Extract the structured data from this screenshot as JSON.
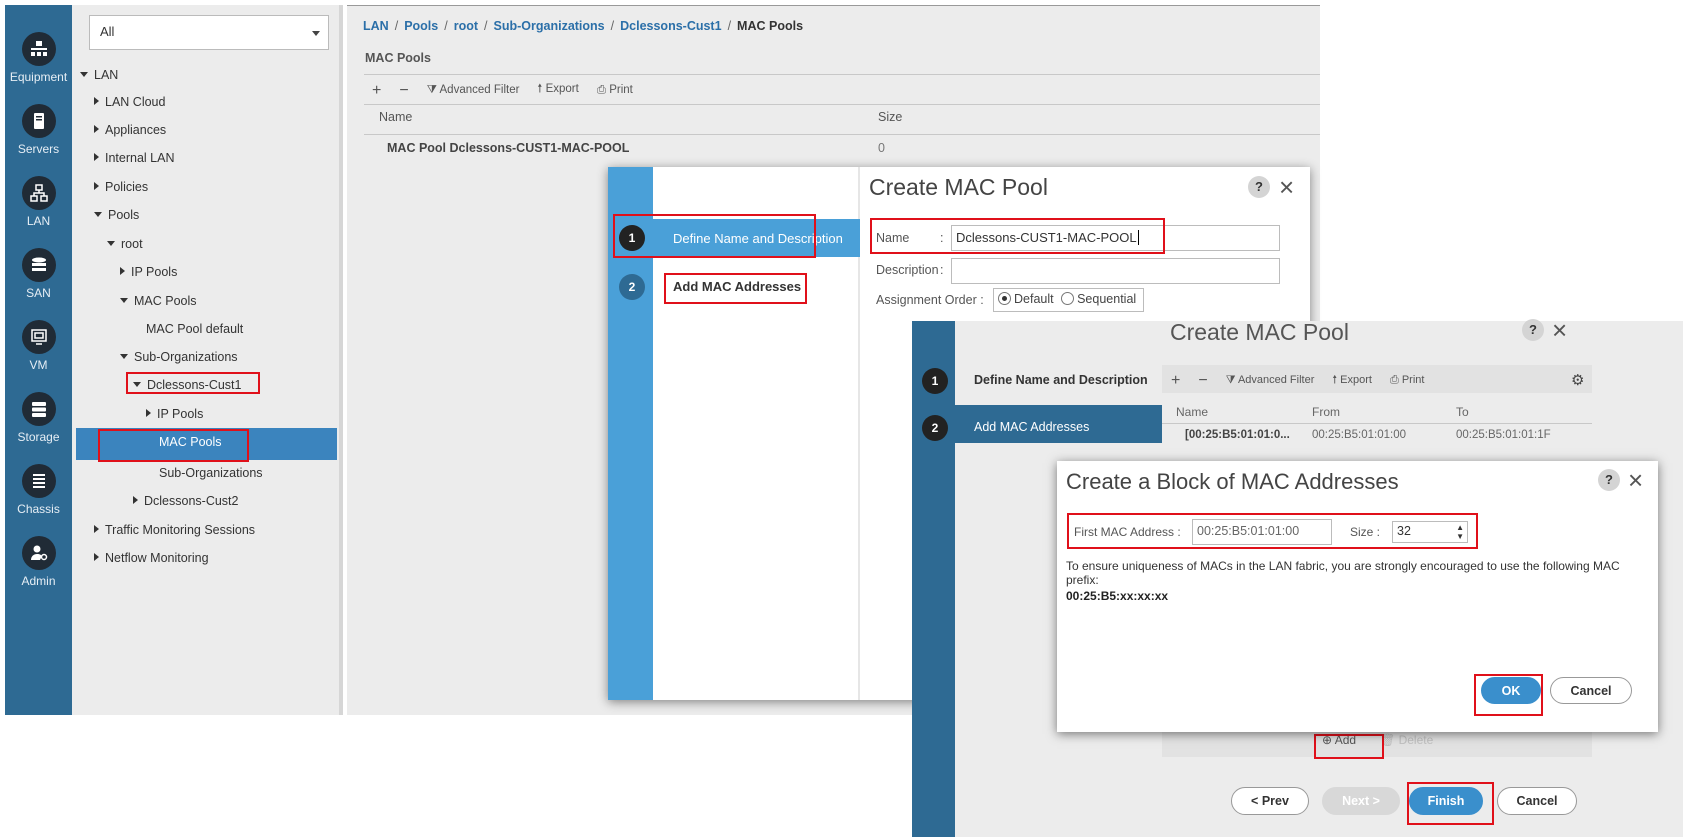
{
  "rail": {
    "items": [
      {
        "label": "Equipment",
        "icon": "equipment-icon"
      },
      {
        "label": "Servers",
        "icon": "server-icon"
      },
      {
        "label": "LAN",
        "icon": "lan-icon"
      },
      {
        "label": "SAN",
        "icon": "san-icon"
      },
      {
        "label": "VM",
        "icon": "vm-icon"
      },
      {
        "label": "Storage",
        "icon": "storage-icon"
      },
      {
        "label": "Chassis",
        "icon": "chassis-icon"
      },
      {
        "label": "Admin",
        "icon": "admin-icon"
      }
    ],
    "active": "LAN"
  },
  "tree": {
    "filter_value": "All",
    "nodes": [
      {
        "label": "LAN",
        "state": "expanded"
      },
      {
        "label": "LAN Cloud",
        "state": "collapsed"
      },
      {
        "label": "Appliances",
        "state": "collapsed"
      },
      {
        "label": "Internal LAN",
        "state": "collapsed"
      },
      {
        "label": "Policies",
        "state": "collapsed"
      },
      {
        "label": "Pools",
        "state": "expanded"
      },
      {
        "label": "root",
        "state": "expanded"
      },
      {
        "label": "IP Pools",
        "state": "collapsed"
      },
      {
        "label": "MAC Pools",
        "state": "expanded"
      },
      {
        "label": "MAC Pool default",
        "state": "leaf"
      },
      {
        "label": "Sub-Organizations",
        "state": "expanded"
      },
      {
        "label": "Dclessons-Cust1",
        "state": "expanded"
      },
      {
        "label": "IP Pools",
        "state": "collapsed"
      },
      {
        "label": "MAC Pools",
        "state": "selected"
      },
      {
        "label": "Sub-Organizations",
        "state": "leaf"
      },
      {
        "label": "Dclessons-Cust2",
        "state": "collapsed"
      },
      {
        "label": "Traffic Monitoring Sessions",
        "state": "collapsed"
      },
      {
        "label": "Netflow Monitoring",
        "state": "collapsed"
      }
    ]
  },
  "main": {
    "breadcrumb": [
      "LAN",
      "Pools",
      "root",
      "Sub-Organizations",
      "Dclessons-Cust1",
      "MAC Pools"
    ],
    "section_title": "MAC Pools",
    "toolbar": {
      "add": "+",
      "remove": "−",
      "filter": "Advanced Filter",
      "export": "Export",
      "print": "Print"
    },
    "table": {
      "columns": [
        "Name",
        "Size"
      ],
      "rows": [
        {
          "name": "MAC Pool Dclessons-CUST1-MAC-POOL",
          "size": "0"
        }
      ]
    }
  },
  "dialog1": {
    "title": "Create MAC Pool",
    "help": "?",
    "steps": [
      {
        "num": "1",
        "label": "Define Name and Description"
      },
      {
        "num": "2",
        "label": "Add MAC Addresses"
      }
    ],
    "name_label": "Name",
    "name_value": "Dclessons-CUST1-MAC-POOL",
    "description_label": "Description",
    "description_value": "",
    "assignment_label": "Assignment Order :",
    "assignment_options": [
      "Default",
      "Sequential"
    ],
    "assignment_selected": "Default"
  },
  "dialog2": {
    "title": "Create MAC Pool",
    "help": "?",
    "steps": [
      {
        "num": "1",
        "label": "Define Name and Description"
      },
      {
        "num": "2",
        "label": "Add MAC Addresses"
      }
    ],
    "toolbar": {
      "add": "+",
      "remove": "−",
      "filter": "Advanced Filter",
      "export": "Export",
      "print": "Print"
    },
    "table": {
      "columns": [
        "Name",
        "From",
        "To"
      ],
      "rows": [
        {
          "name": "[00:25:B5:01:01:0...",
          "from": "00:25:B5:01:01:00",
          "to": "00:25:B5:01:01:1F"
        }
      ]
    },
    "add_label": "Add",
    "delete_label": "Delete",
    "buttons": {
      "prev": "< Prev",
      "next": "Next >",
      "finish": "Finish",
      "cancel": "Cancel"
    }
  },
  "dialog3": {
    "title": "Create a Block of MAC Addresses",
    "help": "?",
    "first_mac_label": "First MAC Address :",
    "first_mac_value": "00:25:B5:01:01:00",
    "size_label": "Size :",
    "size_value": "32",
    "notice": "To ensure uniqueness of MACs in the LAN fabric, you are strongly encouraged to use the following MAC prefix:",
    "prefix": "00:25:B5:xx:xx:xx",
    "buttons": {
      "ok": "OK",
      "cancel": "Cancel"
    }
  },
  "colors": {
    "rail": "#2e6a93",
    "accent_blue": "#4aa0d8",
    "selection_blue": "#3b84be",
    "highlight_red": "#e0101a"
  }
}
